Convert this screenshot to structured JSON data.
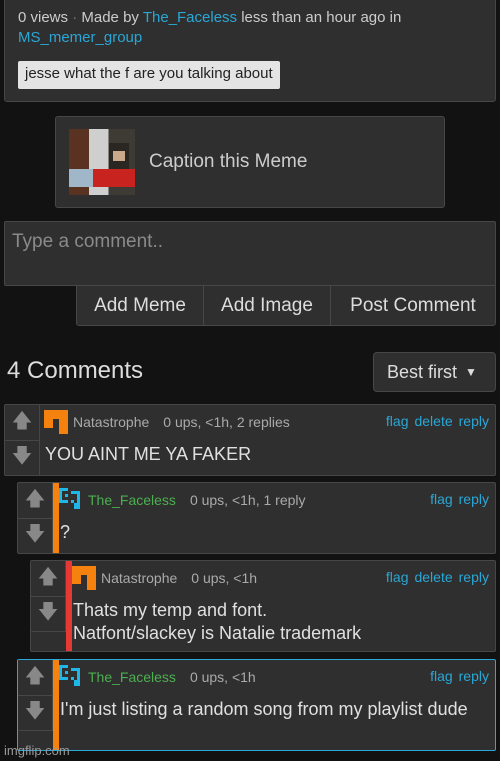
{
  "meme_info": {
    "views": "0 views",
    "sep": "·",
    "made_by": "Made by",
    "author": "The_Faceless",
    "time": "less than an hour ago in",
    "group": "MS_memer_group",
    "tag": "jesse what the f are you talking about"
  },
  "caption": {
    "label": "Caption this Meme"
  },
  "comment_box": {
    "placeholder": "Type a comment.."
  },
  "buttons": {
    "add_meme": "Add Meme",
    "add_image": "Add Image",
    "post_comment": "Post Comment"
  },
  "comments_header": {
    "count": "4 Comments",
    "sort": "Best first"
  },
  "colors": {
    "accent": "#2aa7d6",
    "green_user": "#4caf50",
    "orange": "#f5820f",
    "red": "#e53935",
    "cyan_avatar": "#1fb6ea"
  },
  "comments": [
    {
      "user": "Natastrophe",
      "meta": "0 ups, <1h, 2 replies",
      "text": "YOU AINT ME YA FAKER",
      "actions": [
        "flag",
        "delete",
        "reply"
      ]
    },
    {
      "user": "The_Faceless",
      "meta": "0 ups, <1h, 1 reply",
      "text": "?",
      "actions": [
        "flag",
        "reply"
      ]
    },
    {
      "user": "Natastrophe",
      "meta": "0 ups, <1h",
      "text": "Thats my temp and font.\nNatfont/slackey is Natalie trademark",
      "actions": [
        "flag",
        "delete",
        "reply"
      ]
    },
    {
      "user": "The_Faceless",
      "meta": "0 ups, <1h",
      "text": "I'm just listing a random song from my playlist dude",
      "actions": [
        "flag",
        "reply"
      ]
    }
  ],
  "watermark": "imgflip.com"
}
